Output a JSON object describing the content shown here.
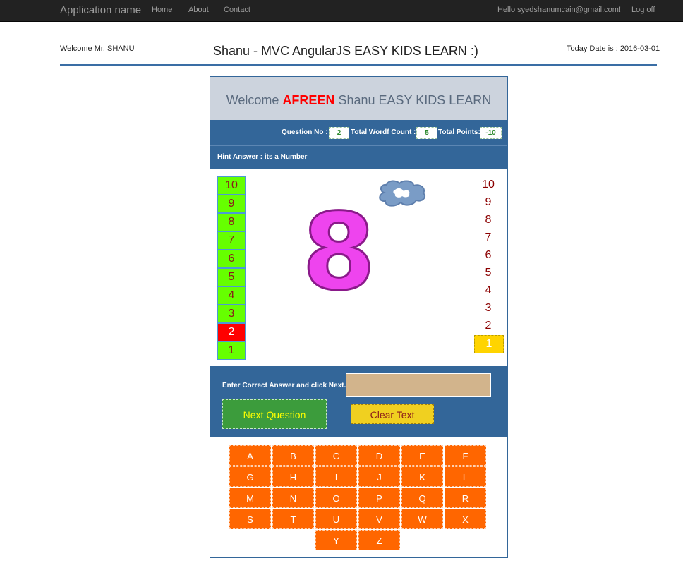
{
  "navbar": {
    "brand": "Application name",
    "links": [
      "Home",
      "About",
      "Contact"
    ],
    "hello": "Hello syedshanumcain@gmail.com!",
    "logoff": "Log off"
  },
  "header": {
    "welcome": "Welcome Mr. SHANU",
    "title": "Shanu - MVC AngularJS EASY KIDS LEARN :)",
    "today": "Today Date is : 2016-03-01"
  },
  "game": {
    "welcome_prefix": "Welcome ",
    "kid_name": "AFREEN",
    "welcome_suffix": " Shanu EASY KIDS LEARN",
    "question_label": "Question No :",
    "question_value": "2",
    "word_count_label": "Total Wordf Count :",
    "word_count_value": "5",
    "points_label": "Total Points:",
    "points_value": "-10",
    "hint": "Hint Answer : its a Number",
    "big_number": "8",
    "left_counter": [
      "10",
      "9",
      "8",
      "7",
      "6",
      "5",
      "4",
      "3",
      "2",
      "1"
    ],
    "left_active": "2",
    "right_counter": [
      "10",
      "9",
      "8",
      "7",
      "6",
      "5",
      "4",
      "3",
      "2",
      "1"
    ],
    "right_active": "1",
    "answer_label": "Enter Correct Answer and click Next.",
    "answer_value": "",
    "next_button": "Next Question",
    "clear_button": "Clear Text",
    "letters": [
      "A",
      "B",
      "C",
      "D",
      "E",
      "F",
      "G",
      "H",
      "I",
      "J",
      "K",
      "L",
      "M",
      "N",
      "O",
      "P",
      "Q",
      "R",
      "S",
      "T",
      "U",
      "V",
      "W",
      "X",
      "Y",
      "Z"
    ]
  },
  "colors": {
    "panel_blue": "#336699",
    "counter_green": "#66ff00",
    "counter_active": "#ff0000",
    "key_orange": "#ff6600",
    "next_green": "#3c9c3c",
    "clear_yellow": "#f0d020"
  }
}
